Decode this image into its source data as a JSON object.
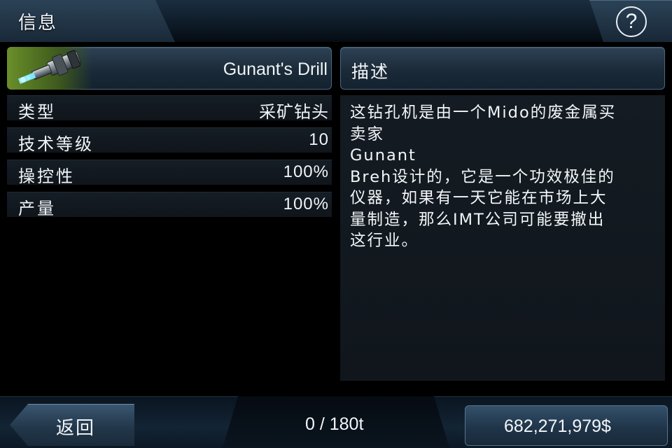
{
  "header": {
    "title": "信息",
    "help_glyph": "?"
  },
  "item": {
    "name": "Gunant's Drill",
    "icon": "drill-icon"
  },
  "stats": [
    {
      "label": "类型",
      "value": "采矿钻头"
    },
    {
      "label": "技术等级",
      "value": "10"
    },
    {
      "label": "操控性",
      "value": "100%"
    },
    {
      "label": "产量",
      "value": "100%"
    }
  ],
  "description": {
    "title": "描述",
    "text": "这钻孔机是由一个Mido的废金属买\n卖家\nGunant\nBreh设计的，它是一个功效极佳的\n仪器，如果有一天它能在市场上大\n量制造，那么IMT公司可能要撤出\n这行业。"
  },
  "footer": {
    "back_label": "返回",
    "cargo": "0 / 180t",
    "credits": "682,271,979$"
  },
  "colors": {
    "panel_border": "#4a6780",
    "panel_top": "#2d4256",
    "background": "#000000"
  }
}
